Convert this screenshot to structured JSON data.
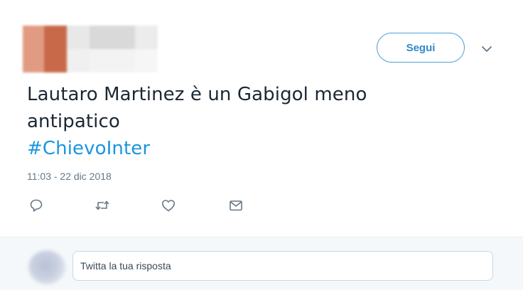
{
  "author": {
    "avatar_colors": [
      "#e39a80",
      "#c8694a"
    ],
    "redacted": true
  },
  "header": {
    "follow_label": "Segui",
    "menu_icon": "chevron-down-icon"
  },
  "tweet": {
    "text_line1": "Lautaro Martinez è un Gabigol meno",
    "text_line2": "antipatico",
    "hashtag": "#ChievoInter",
    "timestamp": "11:03 - 22 dic 2018"
  },
  "actions": {
    "icons": [
      "reply-icon",
      "retweet-icon",
      "like-icon",
      "message-icon"
    ],
    "icon_color": "#657786"
  },
  "reply": {
    "placeholder": "Twitta la tua risposta"
  },
  "colors": {
    "accent": "#1b95e0",
    "text": "#1c2733",
    "muted": "#657786",
    "reply_bar_bg": "#f5f8fa"
  }
}
